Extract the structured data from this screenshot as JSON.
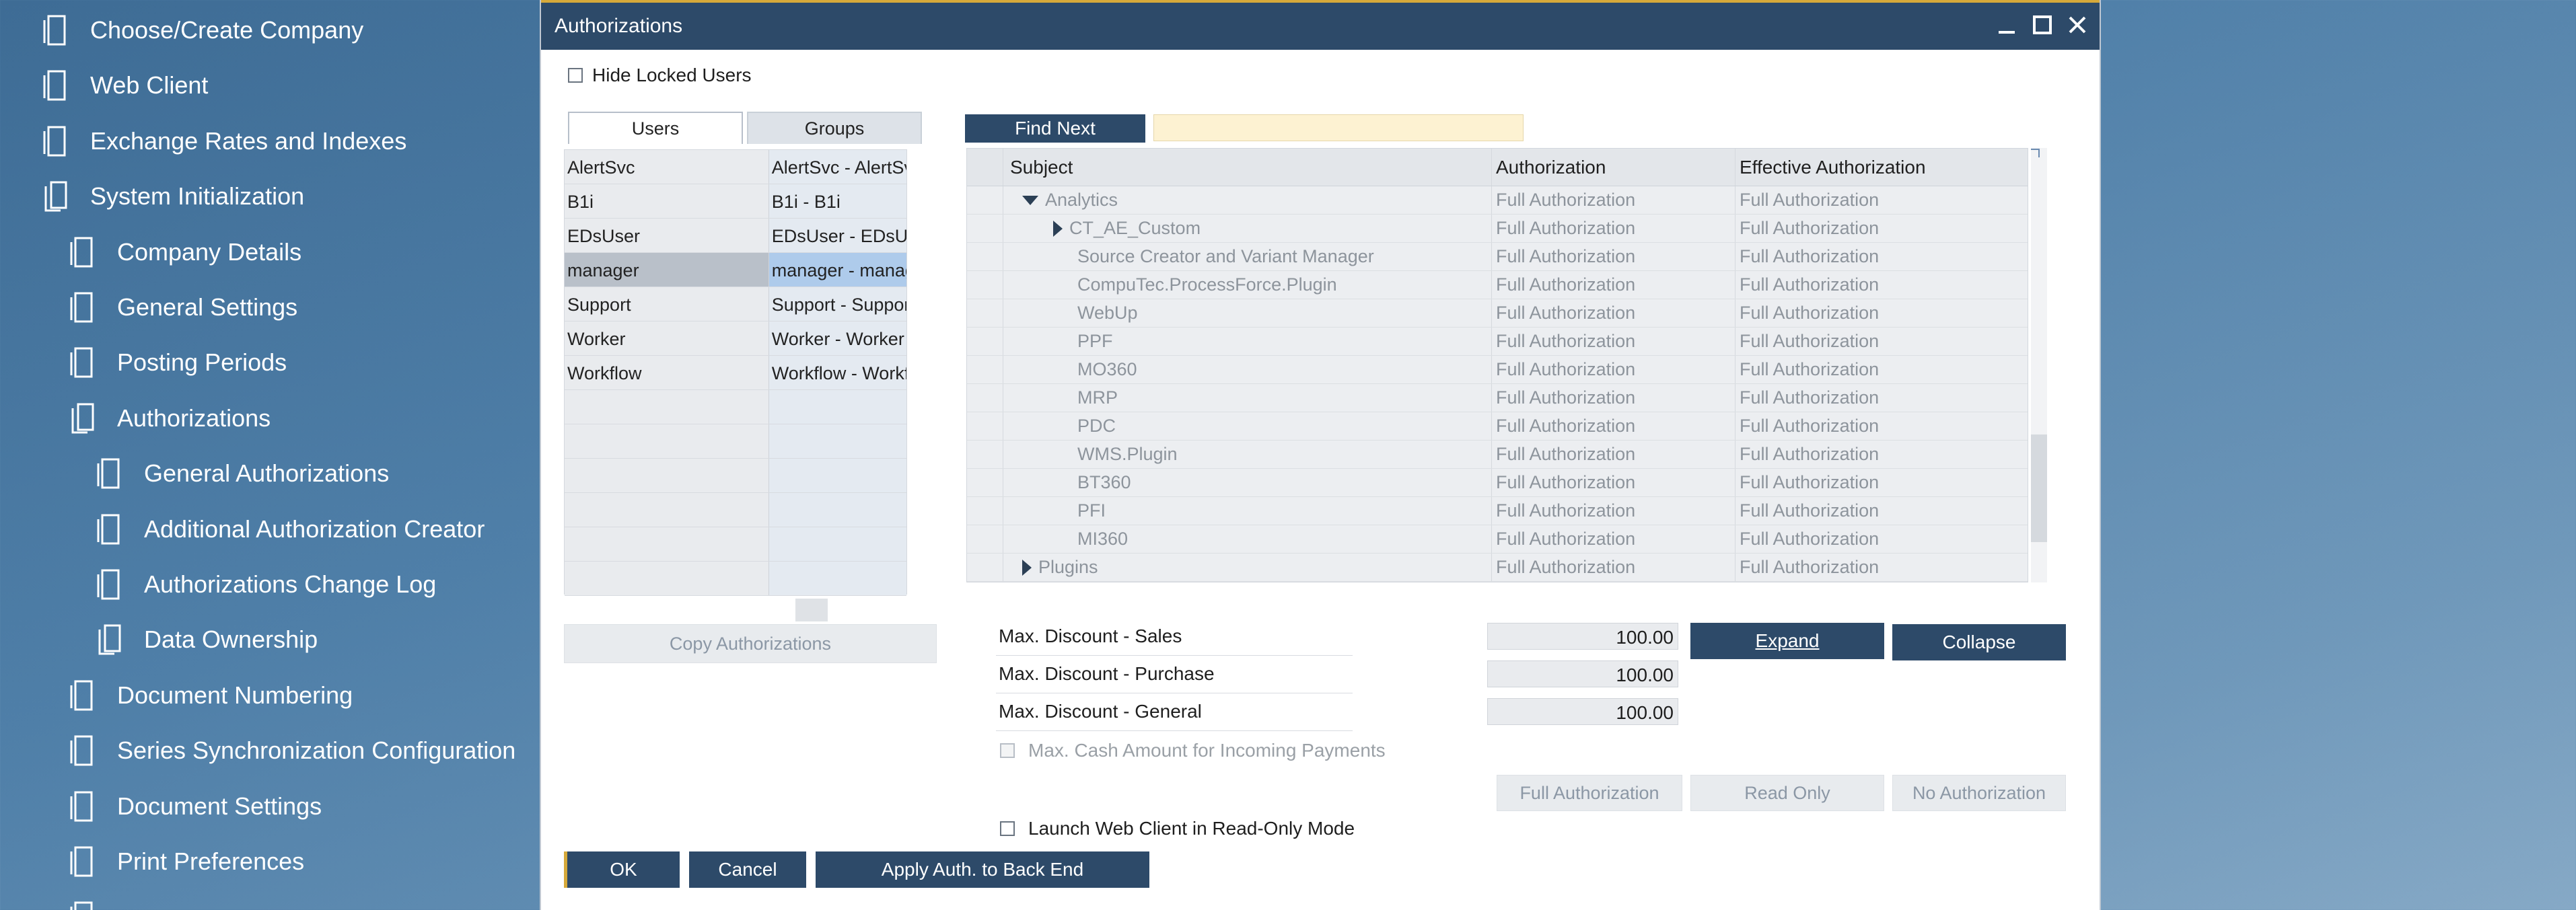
{
  "nav": {
    "items": [
      {
        "label": "Choose/Create Company",
        "level": 0,
        "icon": "document-icon"
      },
      {
        "label": "Web Client",
        "level": 0,
        "icon": "document-icon"
      },
      {
        "label": "Exchange Rates and Indexes",
        "level": 0,
        "icon": "document-icon"
      },
      {
        "label": "System Initialization",
        "level": 0,
        "icon": "folder-icon"
      },
      {
        "label": "Company Details",
        "level": 1,
        "icon": "document-icon"
      },
      {
        "label": "General Settings",
        "level": 1,
        "icon": "document-icon"
      },
      {
        "label": "Posting Periods",
        "level": 1,
        "icon": "document-icon"
      },
      {
        "label": "Authorizations",
        "level": 1,
        "icon": "folder-icon"
      },
      {
        "label": "General Authorizations",
        "level": 2,
        "icon": "document-icon"
      },
      {
        "label": "Additional Authorization Creator",
        "level": 2,
        "icon": "document-icon"
      },
      {
        "label": "Authorizations Change Log",
        "level": 2,
        "icon": "document-icon"
      },
      {
        "label": "Data Ownership",
        "level": 2,
        "icon": "folder-icon"
      },
      {
        "label": "Document Numbering",
        "level": 1,
        "icon": "document-icon"
      },
      {
        "label": "Series Synchronization Configuration",
        "level": 1,
        "icon": "document-icon"
      },
      {
        "label": "Document Settings",
        "level": 1,
        "icon": "document-icon"
      },
      {
        "label": "Print Preferences",
        "level": 1,
        "icon": "document-icon"
      }
    ]
  },
  "dialog": {
    "title": "Authorizations",
    "hide_locked_users": "Hide Locked Users",
    "tabs": [
      "Users",
      "Groups"
    ],
    "users": [
      {
        "code": "AlertSvc",
        "name": "AlertSvc - AlertSvc"
      },
      {
        "code": "B1i",
        "name": "B1i - B1i"
      },
      {
        "code": "EDsUser",
        "name": "EDsUser - EDsUser"
      },
      {
        "code": "manager",
        "name": "manager - manager"
      },
      {
        "code": "Support",
        "name": "Support - Support"
      },
      {
        "code": "Worker",
        "name": "Worker - Worker"
      },
      {
        "code": "Workflow",
        "name": "Workflow - Workflow"
      }
    ],
    "find_next": "Find Next",
    "find_value": "",
    "grid": {
      "headers": [
        "Subject",
        "Authorization",
        "Effective Authorization"
      ],
      "rows": [
        {
          "subject": "Analytics",
          "indent": 1,
          "toggle": "down",
          "auth": "Full Authorization",
          "effective": "Full Authorization"
        },
        {
          "subject": "CT_AE_Custom",
          "indent": 2,
          "toggle": "right",
          "auth": "Full Authorization",
          "effective": "Full Authorization"
        },
        {
          "subject": "Source Creator and Variant Manager",
          "indent": 2,
          "toggle": "",
          "auth": "Full Authorization",
          "effective": "Full Authorization"
        },
        {
          "subject": "CompuTec.ProcessForce.Plugin",
          "indent": 2,
          "toggle": "",
          "auth": "Full Authorization",
          "effective": "Full Authorization"
        },
        {
          "subject": "WebUp",
          "indent": 2,
          "toggle": "",
          "auth": "Full Authorization",
          "effective": "Full Authorization"
        },
        {
          "subject": "PPF",
          "indent": 2,
          "toggle": "",
          "auth": "Full Authorization",
          "effective": "Full Authorization"
        },
        {
          "subject": "MO360",
          "indent": 2,
          "toggle": "",
          "auth": "Full Authorization",
          "effective": "Full Authorization"
        },
        {
          "subject": "MRP",
          "indent": 2,
          "toggle": "",
          "auth": "Full Authorization",
          "effective": "Full Authorization"
        },
        {
          "subject": "PDC",
          "indent": 2,
          "toggle": "",
          "auth": "Full Authorization",
          "effective": "Full Authorization"
        },
        {
          "subject": "WMS.Plugin",
          "indent": 2,
          "toggle": "",
          "auth": "Full Authorization",
          "effective": "Full Authorization"
        },
        {
          "subject": "BT360",
          "indent": 2,
          "toggle": "",
          "auth": "Full Authorization",
          "effective": "Full Authorization"
        },
        {
          "subject": "PFI",
          "indent": 2,
          "toggle": "",
          "auth": "Full Authorization",
          "effective": "Full Authorization"
        },
        {
          "subject": "MI360",
          "indent": 2,
          "toggle": "",
          "auth": "Full Authorization",
          "effective": "Full Authorization"
        },
        {
          "subject": "Plugins",
          "indent": 1,
          "toggle": "right",
          "auth": "Full Authorization",
          "effective": "Full Authorization"
        }
      ]
    },
    "copy_authorizations": "Copy Authorizations",
    "discounts": [
      {
        "label": "Max. Discount - Sales",
        "value": "100.00"
      },
      {
        "label": "Max. Discount - Purchase",
        "value": "100.00"
      },
      {
        "label": "Max. Discount - General",
        "value": "100.00"
      }
    ],
    "expand": "Expand",
    "collapse": "Collapse",
    "max_cash": "Max. Cash Amount for Incoming Payments",
    "full_authorization": "Full Authorization",
    "read_only": "Read Only",
    "no_authorization": "No Authorization",
    "launch_web_client": "Launch Web Client in Read-Only Mode",
    "ok": "OK",
    "cancel": "Cancel",
    "apply_back_end": "Apply Auth. to Back End"
  },
  "colors": {
    "title_bar": "#2d4a69",
    "accent_button": "#2d4a69",
    "selection": "#aecbeb",
    "find_field": "#fdf2d2"
  }
}
